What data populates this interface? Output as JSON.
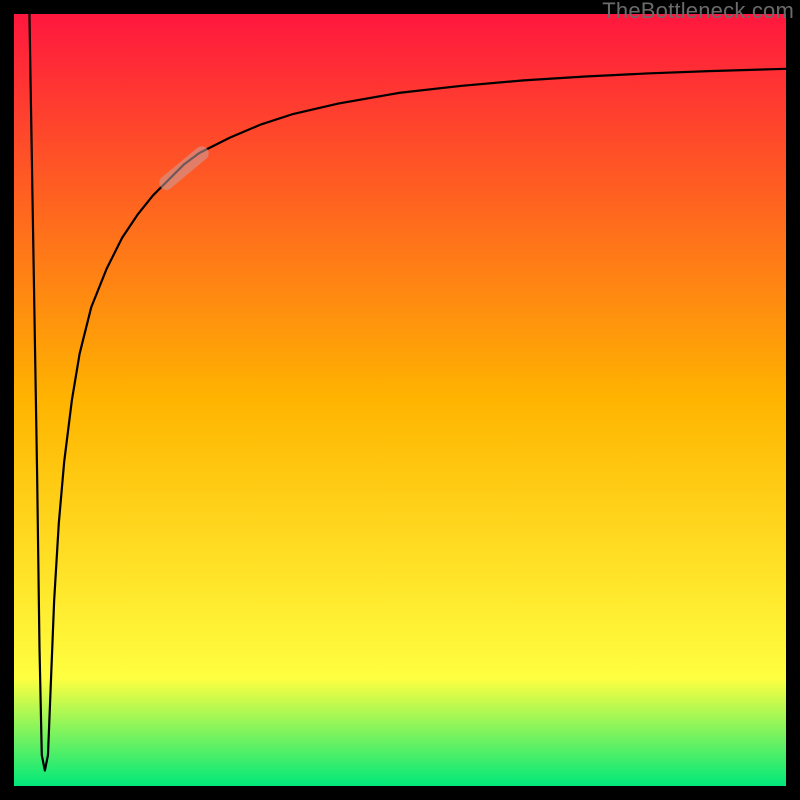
{
  "watermark": "TheBottleneck.com",
  "chart_data": {
    "type": "line",
    "title": "",
    "xlabel": "",
    "ylabel": "",
    "x_range": [
      0,
      100
    ],
    "y_range": [
      0,
      100
    ],
    "grid": false,
    "legend": false,
    "background_gradient": {
      "top_color": "#ff173e",
      "mid1_color": "#ffb400",
      "mid2_color": "#ffff40",
      "bottom_color": "#00e87a",
      "stops": [
        0.0,
        0.5,
        0.86,
        1.0
      ]
    },
    "highlight_band": {
      "x_start": 19,
      "x_end": 25,
      "color": "rgba(200,160,160,0.55)"
    },
    "series": [
      {
        "name": "curve",
        "color": "#000000",
        "stroke_width": 2.2,
        "x": [
          2.0,
          2.5,
          3.0,
          3.3,
          3.6,
          4.0,
          4.4,
          4.8,
          5.2,
          5.8,
          6.5,
          7.5,
          8.5,
          10,
          12,
          14,
          16,
          18,
          20,
          22,
          24,
          28,
          32,
          36,
          42,
          50,
          58,
          66,
          74,
          82,
          90,
          100
        ],
        "y": [
          100,
          70,
          40,
          18,
          4,
          2,
          4,
          14,
          24,
          34,
          42,
          50,
          56,
          62,
          67,
          71,
          74,
          76.5,
          78.5,
          80.5,
          82,
          84,
          85.7,
          87,
          88.4,
          89.8,
          90.7,
          91.4,
          91.9,
          92.3,
          92.6,
          92.9
        ]
      }
    ]
  }
}
